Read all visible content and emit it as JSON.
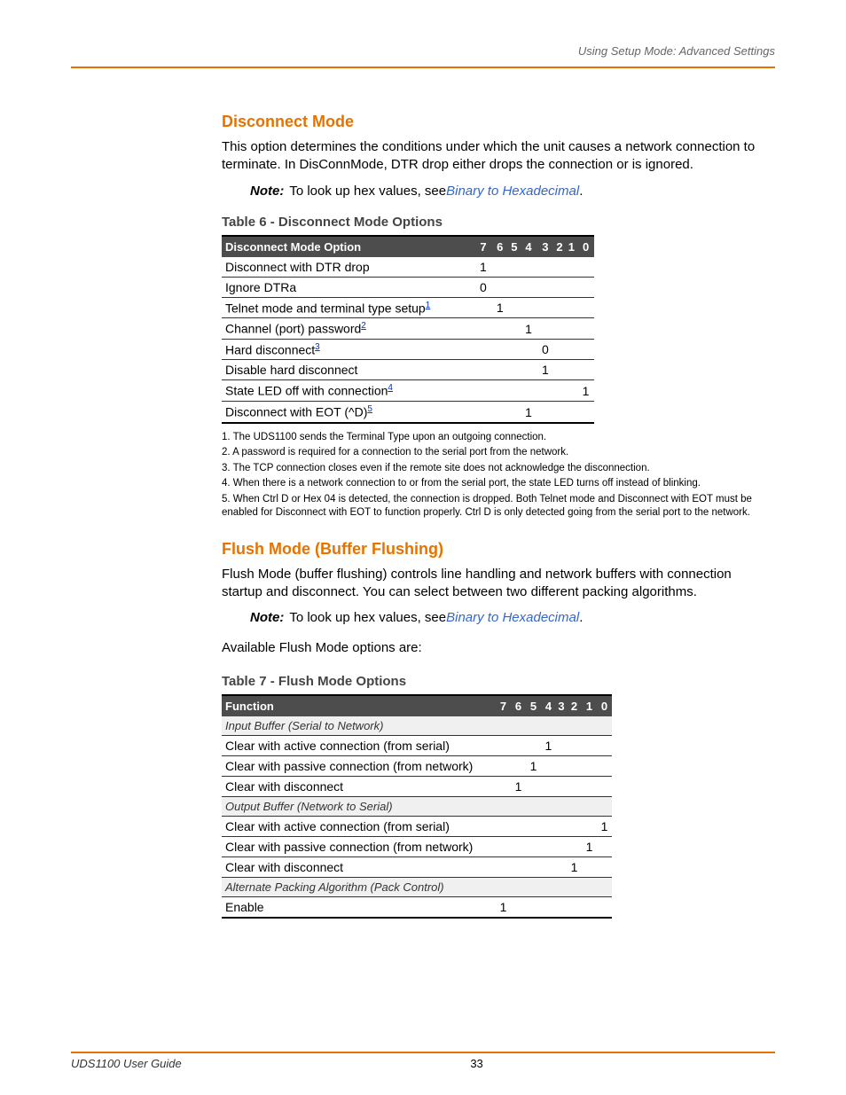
{
  "header": {
    "running_head": "Using Setup Mode: Advanced Settings"
  },
  "section1": {
    "title": "Disconnect Mode",
    "paragraph": "This option determines the conditions under which the unit causes a network connection to terminate. In DisConnMode, DTR drop either drops the connection or is ignored.",
    "note_label": "Note:",
    "note_text": "To look up hex values, see ",
    "note_link": "Binary to Hexadecimal",
    "note_period": "."
  },
  "table6": {
    "caption": "Table 6 - Disconnect Mode Options",
    "headers": [
      "Disconnect Mode Option",
      "7",
      "6",
      "5",
      "4",
      "3",
      "2",
      "1",
      "0"
    ],
    "rows": [
      {
        "label": "Disconnect with DTR drop",
        "sup": "",
        "cells": [
          "1",
          "",
          "",
          "",
          "",
          "",
          "",
          ""
        ]
      },
      {
        "label": "Ignore DTRa",
        "sup": "",
        "cells": [
          "0",
          "",
          "",
          "",
          "",
          "",
          "",
          ""
        ]
      },
      {
        "label": "Telnet mode and terminal type setup",
        "sup": "1",
        "cells": [
          "",
          "1",
          "",
          "",
          "",
          "",
          "",
          ""
        ]
      },
      {
        "label": "Channel (port) password",
        "sup": "2",
        "cells": [
          "",
          "",
          "",
          "1",
          "",
          "",
          "",
          ""
        ]
      },
      {
        "label": "Hard disconnect",
        "sup": "3",
        "cells": [
          "",
          "",
          "",
          "",
          "0",
          "",
          "",
          ""
        ]
      },
      {
        "label": "Disable hard disconnect",
        "sup": "",
        "cells": [
          "",
          "",
          "",
          "",
          "1",
          "",
          "",
          ""
        ]
      },
      {
        "label": "State LED off with connection",
        "sup": "4",
        "cells": [
          "",
          "",
          "",
          "",
          "",
          "",
          "",
          "1"
        ]
      },
      {
        "label": "Disconnect with EOT (^D)",
        "sup": "5",
        "cells": [
          "",
          "",
          "",
          "1",
          "",
          "",
          "",
          ""
        ]
      }
    ]
  },
  "footnotes1": [
    "1. The UDS1100 sends the Terminal Type upon an outgoing connection.",
    "2. A password is required for a connection to the serial port from the network.",
    "3. The TCP connection closes even if the remote site does not acknowledge the disconnection.",
    "4. When there is a network connection to or from the serial port, the state LED turns off instead of blinking.",
    "5. When Ctrl D or Hex 04 is detected, the connection is dropped. Both Telnet mode and Disconnect with EOT must be enabled for Disconnect with EOT to function properly. Ctrl D is only detected going from the serial port to the network."
  ],
  "section2": {
    "title": "Flush Mode (Buffer Flushing)",
    "paragraph": "Flush Mode (buffer flushing) controls line handling and network buffers with connection startup and disconnect. You can select between two different packing algorithms.",
    "note_label": "Note:",
    "note_text": "To look up hex values, see ",
    "note_link": "Binary to Hexadecimal",
    "note_period": ".",
    "available": "Available Flush Mode options are:"
  },
  "table7": {
    "caption": "Table 7 - Flush Mode Options",
    "headers": [
      "Function",
      "7",
      "6",
      "5",
      "4",
      "3",
      "2",
      "1",
      "0"
    ],
    "sub1": "Input Buffer (Serial to Network)",
    "rows1": [
      {
        "label": "Clear with active connection (from serial)",
        "cells": [
          "",
          "",
          "",
          "1",
          "",
          "",
          "",
          ""
        ]
      },
      {
        "label": "Clear with passive connection (from network)",
        "cells": [
          "",
          "",
          "1",
          "",
          "",
          "",
          "",
          ""
        ]
      },
      {
        "label": "Clear with disconnect",
        "cells": [
          "",
          "1",
          "",
          "",
          "",
          "",
          "",
          ""
        ]
      }
    ],
    "sub2": "Output Buffer (Network to Serial)",
    "rows2": [
      {
        "label": "Clear with active connection (from serial)",
        "cells": [
          "",
          "",
          "",
          "",
          "",
          "",
          "",
          "1"
        ]
      },
      {
        "label": "Clear with passive connection (from network)",
        "cells": [
          "",
          "",
          "",
          "",
          "",
          "",
          "1",
          ""
        ]
      },
      {
        "label": "Clear with disconnect",
        "cells": [
          "",
          "",
          "",
          "",
          "",
          "1",
          "",
          ""
        ]
      }
    ],
    "sub3": "Alternate Packing Algorithm (Pack Control)",
    "rows3": [
      {
        "label": "Enable",
        "cells": [
          "1",
          "",
          "",
          "",
          "",
          "",
          "",
          ""
        ]
      }
    ]
  },
  "footer": {
    "product": "UDS1100 User Guide",
    "page": "33"
  }
}
